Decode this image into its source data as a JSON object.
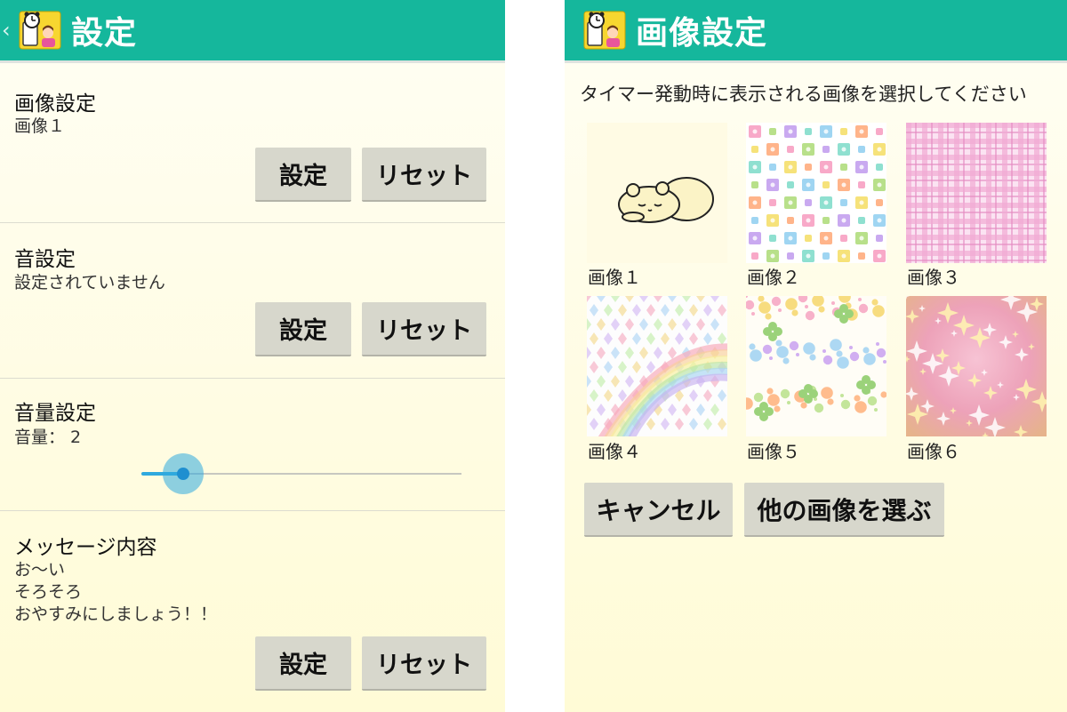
{
  "left_screen": {
    "header": {
      "back_glyph": "‹",
      "title": "設定",
      "icon": "alarm-clock-app-icon"
    },
    "sections": [
      {
        "title": "画像設定",
        "value": "画像１",
        "set_label": "設定",
        "reset_label": "リセット"
      },
      {
        "title": "音設定",
        "value": "設定されていません",
        "set_label": "設定",
        "reset_label": "リセット"
      },
      {
        "title": "音量設定",
        "value": "音量： 2",
        "slider_level": 0.13
      },
      {
        "title": "メッセージ内容",
        "lines": [
          "お～い",
          "そろそろ",
          "おやすみにしましょう！！"
        ],
        "set_label": "設定",
        "reset_label": "リセット"
      }
    ]
  },
  "right_screen": {
    "header": {
      "title": "画像設定",
      "icon": "alarm-clock-app-icon"
    },
    "instruction": "タイマー発動時に表示される画像を選択してください",
    "images": [
      {
        "label": "画像１",
        "icon": "sleeping-bear-image"
      },
      {
        "label": "画像２",
        "icon": "colorful-tiles-image"
      },
      {
        "label": "画像３",
        "icon": "pink-plaid-image"
      },
      {
        "label": "画像４",
        "icon": "rainbow-diamonds-image"
      },
      {
        "label": "画像５",
        "icon": "dots-and-clovers-image"
      },
      {
        "label": "画像６",
        "icon": "pink-sparkle-image"
      }
    ],
    "cancel_label": "キャンセル",
    "choose_other_label": "他の画像を選ぶ"
  },
  "colors": {
    "header": "#15b79c",
    "background": "#fffbd6",
    "button": "#d7d7cc",
    "slider_accent": "#2fa9de"
  }
}
